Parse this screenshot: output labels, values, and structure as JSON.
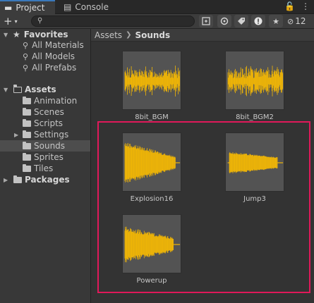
{
  "tabs": {
    "project": "Project",
    "console": "Console"
  },
  "window_controls": {
    "lock": "🔓",
    "menu": "⋮"
  },
  "toolbar": {
    "add_symbol": "+",
    "add_caret": "▾",
    "search_placeholder": "",
    "hidden_count": "12"
  },
  "tree": {
    "favorites_label": "Favorites",
    "favorites": [
      "All Materials",
      "All Models",
      "All Prefabs"
    ],
    "assets_label": "Assets",
    "assets_children": [
      "Animation",
      "Scenes",
      "Scripts",
      "Settings",
      "Sounds",
      "Sprites",
      "Tiles"
    ],
    "selected": "Sounds",
    "packages_label": "Packages"
  },
  "breadcrumb": {
    "root": "Assets",
    "current": "Sounds"
  },
  "assets": [
    {
      "name": "8bit_BGM",
      "waveform": "bgm"
    },
    {
      "name": "8bit_BGM2",
      "waveform": "bgm"
    },
    {
      "name": "Explosion16",
      "waveform": "decay"
    },
    {
      "name": "Jump3",
      "waveform": "jump"
    },
    {
      "name": "Powerup",
      "waveform": "decay"
    }
  ],
  "colors": {
    "waveform": "#f2b705",
    "highlight": "#e0195a",
    "accent": "#3a79bb"
  }
}
